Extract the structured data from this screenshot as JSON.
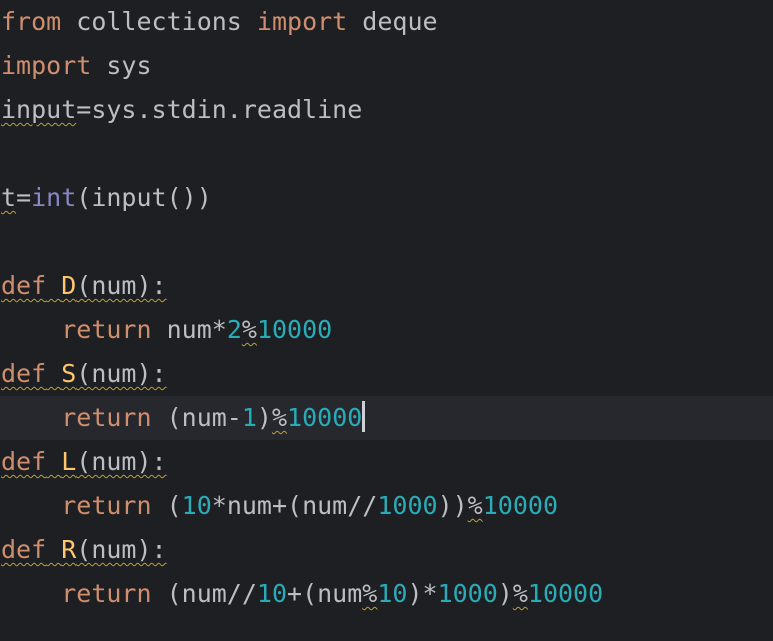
{
  "editor": {
    "theme_colors": {
      "background": "#1e1f22",
      "current_line": "#26282e",
      "keyword": "#cf8e6d",
      "identifier": "#bcbec4",
      "function_name": "#ffc66d",
      "builtin": "#8888c6",
      "number": "#2aacb8",
      "warning_underline": "#b9a23d",
      "caret": "#ced0d6"
    },
    "caret_line": 11,
    "lines": [
      {
        "tokens": [
          {
            "t": "from",
            "c": "kw"
          },
          {
            "t": " ",
            "c": "ws"
          },
          {
            "t": "collections",
            "c": "id"
          },
          {
            "t": " ",
            "c": "ws"
          },
          {
            "t": "import",
            "c": "kw"
          },
          {
            "t": " ",
            "c": "ws"
          },
          {
            "t": "deque",
            "c": "id"
          }
        ]
      },
      {
        "tokens": [
          {
            "t": "import",
            "c": "kw"
          },
          {
            "t": " ",
            "c": "ws"
          },
          {
            "t": "sys",
            "c": "id"
          }
        ]
      },
      {
        "tokens": [
          {
            "t": "input",
            "c": "id",
            "w": true
          },
          {
            "t": "=",
            "c": "op"
          },
          {
            "t": "sys.stdin.readline",
            "c": "id"
          }
        ]
      },
      {
        "tokens": []
      },
      {
        "tokens": [
          {
            "t": "t",
            "c": "id",
            "w": true
          },
          {
            "t": "=",
            "c": "op"
          },
          {
            "t": "int",
            "c": "bi"
          },
          {
            "t": "(input())",
            "c": "punc"
          }
        ]
      },
      {
        "tokens": []
      },
      {
        "tokens": [
          {
            "t": "def",
            "c": "kw",
            "w": true
          },
          {
            "t": " ",
            "c": "ws",
            "w": true
          },
          {
            "t": "D",
            "c": "nm",
            "w": true
          },
          {
            "t": "(num):",
            "c": "punc",
            "w": true
          }
        ]
      },
      {
        "tokens": [
          {
            "t": "    ",
            "c": "ws"
          },
          {
            "t": "return",
            "c": "kw"
          },
          {
            "t": " ",
            "c": "ws"
          },
          {
            "t": "num*",
            "c": "id"
          },
          {
            "t": "2",
            "c": "num"
          },
          {
            "t": "%",
            "c": "op",
            "w": true
          },
          {
            "t": "10000",
            "c": "num"
          }
        ]
      },
      {
        "tokens": [
          {
            "t": "def",
            "c": "kw",
            "w": true
          },
          {
            "t": " ",
            "c": "ws",
            "w": true
          },
          {
            "t": "S",
            "c": "nm",
            "w": true
          },
          {
            "t": "(num):",
            "c": "punc",
            "w": true
          }
        ]
      },
      {
        "tokens": [
          {
            "t": "    ",
            "c": "ws"
          },
          {
            "t": "return",
            "c": "kw"
          },
          {
            "t": " ",
            "c": "ws"
          },
          {
            "t": "(num-",
            "c": "id"
          },
          {
            "t": "1",
            "c": "num"
          },
          {
            "t": ")",
            "c": "punc"
          },
          {
            "t": "%",
            "c": "op",
            "w": true
          },
          {
            "t": "10000",
            "c": "num"
          }
        ]
      },
      {
        "tokens": [
          {
            "t": "def",
            "c": "kw",
            "w": true
          },
          {
            "t": " ",
            "c": "ws",
            "w": true
          },
          {
            "t": "L",
            "c": "nm",
            "w": true
          },
          {
            "t": "(num):",
            "c": "punc",
            "w": true
          }
        ]
      },
      {
        "tokens": [
          {
            "t": "    ",
            "c": "ws"
          },
          {
            "t": "return",
            "c": "kw"
          },
          {
            "t": " ",
            "c": "ws"
          },
          {
            "t": "(",
            "c": "punc"
          },
          {
            "t": "10",
            "c": "num"
          },
          {
            "t": "*num+(num//",
            "c": "id"
          },
          {
            "t": "1000",
            "c": "num"
          },
          {
            "t": "))",
            "c": "punc"
          },
          {
            "t": "%",
            "c": "op",
            "w": true
          },
          {
            "t": "10000",
            "c": "num"
          }
        ]
      },
      {
        "tokens": [
          {
            "t": "def",
            "c": "kw",
            "w": true
          },
          {
            "t": " ",
            "c": "ws",
            "w": true
          },
          {
            "t": "R",
            "c": "nm",
            "w": true
          },
          {
            "t": "(num):",
            "c": "punc",
            "w": true
          }
        ]
      },
      {
        "tokens": [
          {
            "t": "    ",
            "c": "ws"
          },
          {
            "t": "return",
            "c": "kw"
          },
          {
            "t": " ",
            "c": "ws"
          },
          {
            "t": "(num//",
            "c": "id"
          },
          {
            "t": "10",
            "c": "num"
          },
          {
            "t": "+(num",
            "c": "id"
          },
          {
            "t": "%",
            "c": "op",
            "w": true
          },
          {
            "t": "10",
            "c": "num"
          },
          {
            "t": ")*",
            "c": "id"
          },
          {
            "t": "1000",
            "c": "num"
          },
          {
            "t": ")",
            "c": "punc"
          },
          {
            "t": "%",
            "c": "op",
            "w": true
          },
          {
            "t": "10000",
            "c": "num"
          }
        ]
      }
    ]
  }
}
